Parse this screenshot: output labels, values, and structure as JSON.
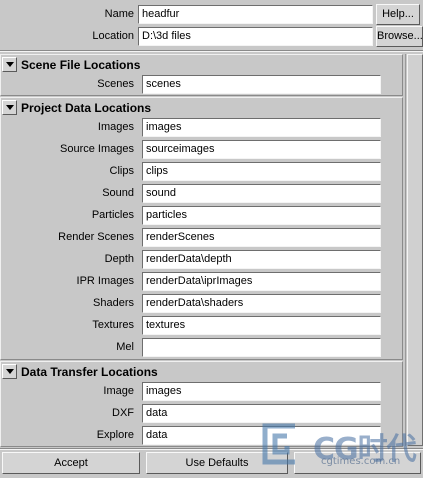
{
  "header": {
    "name_label": "Name",
    "name_value": "headfur",
    "help_button": "Help...",
    "location_label": "Location",
    "location_value": "D:\\3d files",
    "browse_button": "Browse..."
  },
  "sections": {
    "scene": {
      "title": "Scene File Locations",
      "rows": [
        {
          "label": "Scenes",
          "value": "scenes"
        }
      ]
    },
    "project": {
      "title": "Project Data Locations",
      "rows": [
        {
          "label": "Images",
          "value": "images"
        },
        {
          "label": "Source Images",
          "value": "sourceimages"
        },
        {
          "label": "Clips",
          "value": "clips"
        },
        {
          "label": "Sound",
          "value": "sound"
        },
        {
          "label": "Particles",
          "value": "particles"
        },
        {
          "label": "Render Scenes",
          "value": "renderScenes"
        },
        {
          "label": "Depth",
          "value": "renderData\\depth"
        },
        {
          "label": "IPR Images",
          "value": "renderData\\iprImages"
        },
        {
          "label": "Shaders",
          "value": "renderData\\shaders"
        },
        {
          "label": "Textures",
          "value": "textures"
        },
        {
          "label": "Mel",
          "value": ""
        }
      ]
    },
    "transfer": {
      "title": "Data Transfer Locations",
      "rows": [
        {
          "label": "Image",
          "value": "images"
        },
        {
          "label": "DXF",
          "value": "data"
        },
        {
          "label": "Explore",
          "value": "data"
        }
      ]
    }
  },
  "footer": {
    "accept": "Accept",
    "use_defaults": "Use Defaults"
  },
  "watermark": {
    "text": "CG时代",
    "url": "cgtimes.com.cn"
  },
  "icons": {
    "collapse": "collapse-triangle-icon",
    "logo": "cg-logo-icon"
  }
}
